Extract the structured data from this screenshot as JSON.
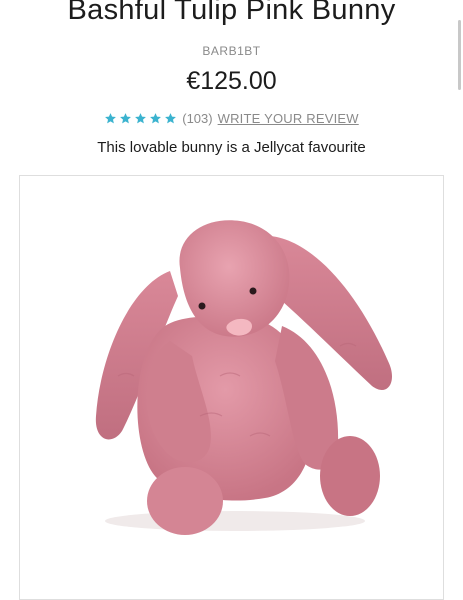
{
  "product": {
    "title": "Bashful Tulip Pink Bunny",
    "sku": "BARB1BT",
    "price": "€125.00",
    "rating": {
      "stars": 5,
      "count": "(103)",
      "review_link": "WRITE YOUR REVIEW"
    },
    "tagline": "This lovable bunny is a Jellycat favourite",
    "image": {
      "alt": "Pink plush bunny with long floppy ears"
    }
  },
  "colors": {
    "star": "#3bb3cf",
    "bunny_pink": "#d68796",
    "bunny_shadow": "#b9677a",
    "nose": "#f4b8c1"
  }
}
